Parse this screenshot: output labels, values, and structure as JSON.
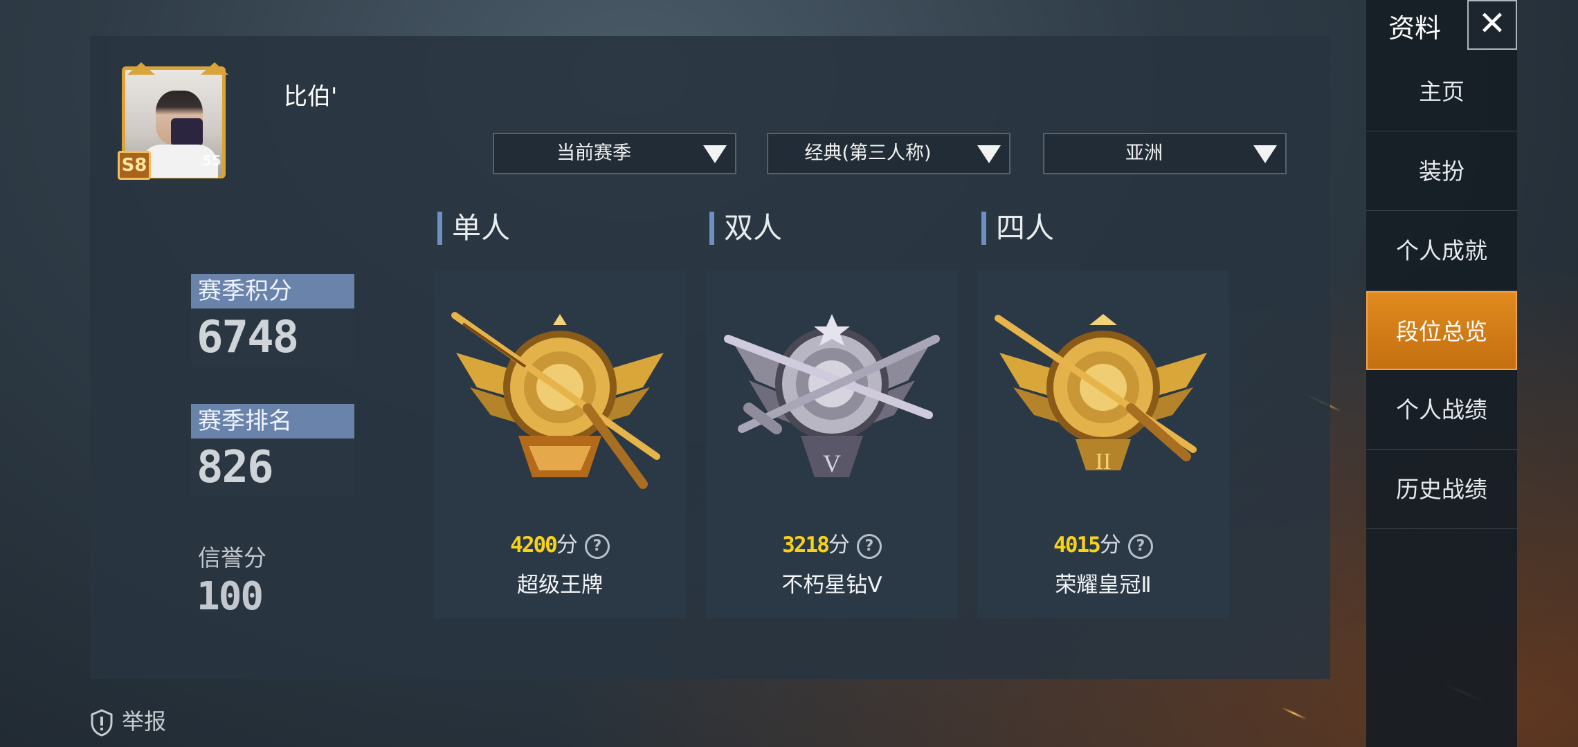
{
  "profile": {
    "name": "比伯'",
    "season_badge": "S8",
    "level": "55"
  },
  "filters": {
    "season": "当前赛季",
    "mode": "经典(第三人称)",
    "region": "亚洲"
  },
  "stats": {
    "season_points_label": "赛季积分",
    "season_points": "6748",
    "season_rank_label": "赛季排名",
    "season_rank": "826",
    "credit_label": "信誉分",
    "credit": "100"
  },
  "modes": [
    {
      "title": "单人",
      "score": "4200",
      "unit": "分",
      "tier": "超级王牌",
      "emblem": "ace-gold-emblem-icon"
    },
    {
      "title": "双人",
      "score": "3218",
      "unit": "分",
      "tier": "不朽星钻Ⅴ",
      "emblem": "diamond-silver-emblem-icon"
    },
    {
      "title": "四人",
      "score": "4015",
      "unit": "分",
      "tier": "荣耀皇冠Ⅱ",
      "emblem": "crown-gold-emblem-icon"
    }
  ],
  "report": {
    "label": "举报"
  },
  "nav": {
    "title": "资料",
    "items": [
      "主页",
      "装扮",
      "个人成就",
      "段位总览",
      "个人战绩",
      "历史战绩"
    ],
    "active": "段位总览"
  },
  "colors": {
    "accent_orange": "#e08a1f",
    "score_yellow": "#f8d21a",
    "label_blue": "#6a83ab"
  }
}
